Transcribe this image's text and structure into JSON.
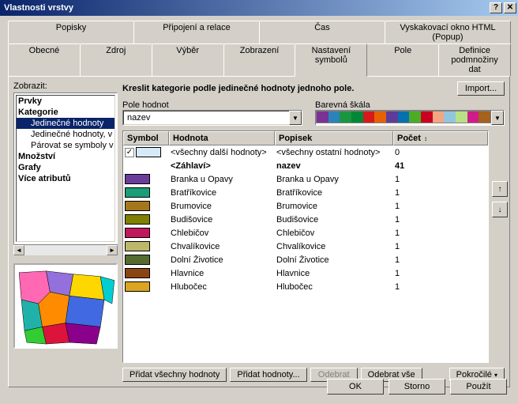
{
  "title": "Vlastnosti vrstvy",
  "tabs_row1": [
    "Popisky",
    "Připojení a relace",
    "Čas",
    "Vyskakovací okno HTML (Popup)"
  ],
  "tabs_row2": [
    "Obecné",
    "Zdroj",
    "Výběr",
    "Zobrazení",
    "Nastavení symbolů",
    "Pole",
    "Definice podmnožiny dat"
  ],
  "active_tab": "Nastavení symbolů",
  "zobrazit": "Zobrazit:",
  "tree": {
    "prvky": "Prvky",
    "kategorie": "Kategorie",
    "jedinecne": "Jedinečné hodnoty",
    "jedinecne_v": "Jedinečné hodnoty, v",
    "parovat": "Párovat se symboly v",
    "mnozstvi": "Množství",
    "grafy": "Grafy",
    "vice": "Více atributů"
  },
  "desc": "Kreslit kategorie podle jedinečné hodnoty jednoho pole.",
  "import_btn": "Import...",
  "pole_hodnot": "Pole hodnot",
  "pole_value": "nazev",
  "barevna_skala": "Barevná škála",
  "ramp_colors": [
    "#7b3294",
    "#2b83ba",
    "#1a9641",
    "#008837",
    "#d7191c",
    "#e66101",
    "#5e3c99",
    "#0571b0",
    "#4dac26",
    "#ca0020",
    "#f4a582",
    "#92c5de",
    "#b8e186",
    "#d01c8b",
    "#a6611a"
  ],
  "headers": {
    "symbol": "Symbol",
    "hodnota": "Hodnota",
    "popisek": "Popisek",
    "pocet": "Počet"
  },
  "rows": [
    {
      "check": true,
      "color": "#d6eaf8",
      "val": "<všechny další hodnoty>",
      "pop": "<všechny ostatní hodnoty>",
      "cnt": "0"
    },
    {
      "header": true,
      "val": "<Záhlaví>",
      "pop": "nazev",
      "cnt": "41"
    },
    {
      "color": "#6a3d9a",
      "val": "Branka u Opavy",
      "pop": "Branka u Opavy",
      "cnt": "1"
    },
    {
      "color": "#1b9e77",
      "val": "Bratříkovice",
      "pop": "Bratříkovice",
      "cnt": "1"
    },
    {
      "color": "#a6761d",
      "val": "Brumovice",
      "pop": "Brumovice",
      "cnt": "1"
    },
    {
      "color": "#808000",
      "val": "Budišovice",
      "pop": "Budišovice",
      "cnt": "1"
    },
    {
      "color": "#c2185b",
      "val": "Chlebičov",
      "pop": "Chlebičov",
      "cnt": "1"
    },
    {
      "color": "#bdb76b",
      "val": "Chvalíkovice",
      "pop": "Chvalíkovice",
      "cnt": "1"
    },
    {
      "color": "#556b2f",
      "val": "Dolní Životice",
      "pop": "Dolní Životice",
      "cnt": "1"
    },
    {
      "color": "#8b4513",
      "val": "Hlavnice",
      "pop": "Hlavnice",
      "cnt": "1"
    },
    {
      "color": "#daa520",
      "val": "Hlubočec",
      "pop": "Hlubočec",
      "cnt": "1"
    }
  ],
  "btns": {
    "add_all": "Přidat všechny hodnoty",
    "add": "Přidat hodnoty...",
    "remove": "Odebrat",
    "remove_all": "Odebrat vše",
    "advanced": "Pokročilé"
  },
  "footer": {
    "ok": "OK",
    "storno": "Storno",
    "pouzit": "Použít"
  }
}
